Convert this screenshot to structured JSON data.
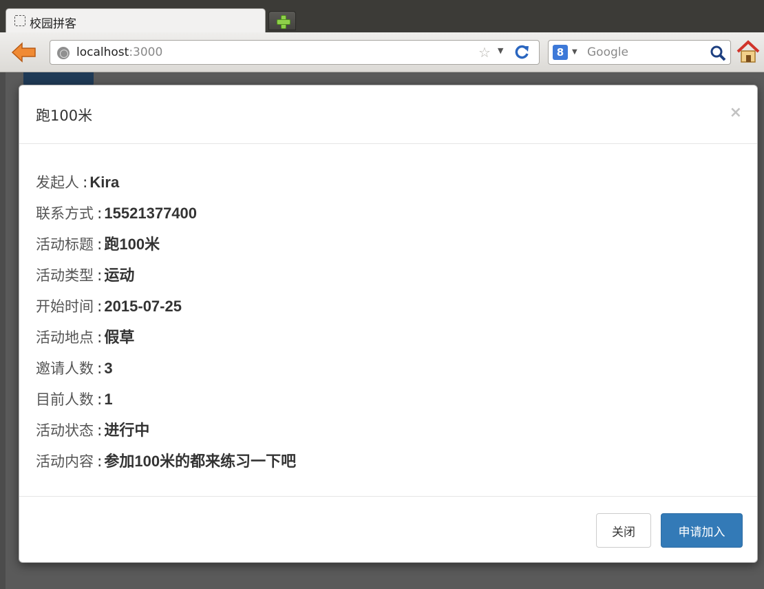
{
  "browser": {
    "tab_title": "校园拼客",
    "url_host": "localhost",
    "url_port": ":3000",
    "search_placeholder": "Google"
  },
  "modal": {
    "title": "跑100米",
    "close_symbol": "×",
    "fields": [
      {
        "label": "发起人",
        "value": "Kira"
      },
      {
        "label": "联系方式",
        "value": "15521377400"
      },
      {
        "label": "活动标题",
        "value": "跑100米"
      },
      {
        "label": "活动类型",
        "value": "运动"
      },
      {
        "label": "开始时间",
        "value": "2015-07-25"
      },
      {
        "label": "活动地点",
        "value": "假草"
      },
      {
        "label": "邀请人数",
        "value": "3"
      },
      {
        "label": "目前人数",
        "value": "1"
      },
      {
        "label": "活动状态",
        "value": "进行中"
      },
      {
        "label": "活动内容",
        "value": "参加100米的都来练习一下吧"
      }
    ],
    "separator": ":",
    "close_button": "关闭",
    "join_button": "申请加入"
  },
  "icons": {
    "back": "back-arrow-icon",
    "reload": "reload-icon",
    "search": "magnifier-icon",
    "home": "home-icon"
  },
  "colors": {
    "primary_button": "#337ab7",
    "back_arrow": "#e8772e"
  }
}
